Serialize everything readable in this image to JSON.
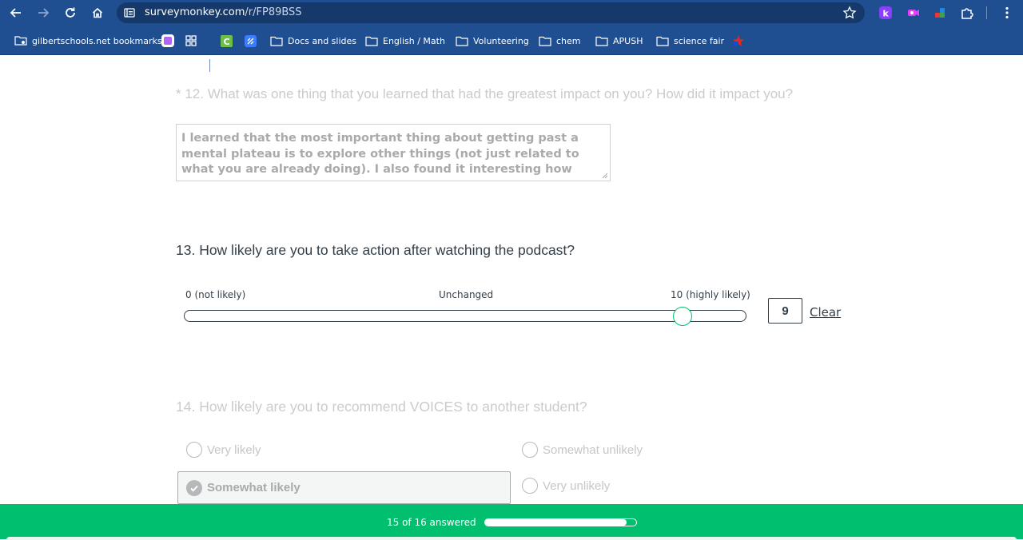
{
  "browser": {
    "url_domain": "surveymonkey.com",
    "url_path": "/r/FP89BSS"
  },
  "bookmarks": {
    "items": [
      {
        "label": "gilbertschools.net bookmarks"
      },
      {
        "label": "Docs and slides"
      },
      {
        "label": "English / Math"
      },
      {
        "label": "Volunteering"
      },
      {
        "label": "chem"
      },
      {
        "label": "APUSH"
      },
      {
        "label": "science fair"
      }
    ]
  },
  "survey": {
    "q12": {
      "text": "* 12. What was one thing that you learned that had the greatest impact on you? How did it impact you?",
      "answer": "I learned that the most important thing about getting past a mental plateau is to explore other things (not just related to what you are already doing). I also found it interesting how"
    },
    "q13": {
      "text": "13. How likely are you to take action after watching the podcast?",
      "min_label": "0 (not likely)",
      "mid_label": "Unchanged",
      "max_label": "10 (highly likely)",
      "min": 0,
      "max": 10,
      "value": 9,
      "value_display": "9",
      "clear_label": "Clear"
    },
    "q14": {
      "text": "14. How likely are you to recommend VOICES to another student?",
      "options": [
        {
          "label": "Very likely",
          "selected": false
        },
        {
          "label": "Somewhat unlikely",
          "selected": false
        },
        {
          "label": "Somewhat likely",
          "selected": true
        },
        {
          "label": "Very unlikely",
          "selected": false
        }
      ]
    }
  },
  "progress": {
    "text": "15 of 16 answered",
    "answered": 15,
    "total": 16
  },
  "colors": {
    "brand_green": "#00bf6f",
    "chrome_blue": "#1f4e91",
    "text_dark": "#333e48"
  }
}
